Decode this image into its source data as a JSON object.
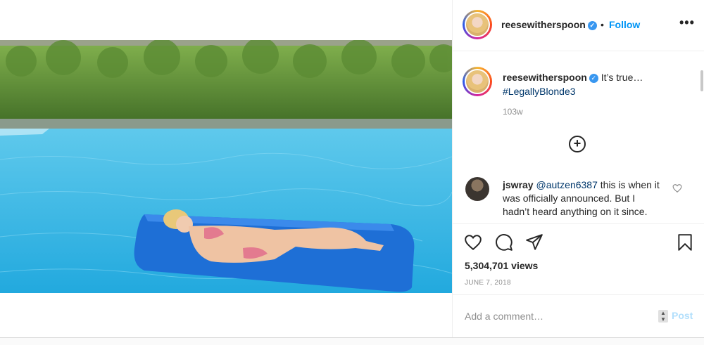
{
  "post": {
    "username": "reesewitherspoon",
    "separator": "•",
    "follow_label": "Follow",
    "more_label": "•••",
    "verified_mark": "✓",
    "caption": {
      "username": "reesewitherspoon",
      "text": "It’s true…",
      "hashtag": "#LegallyBlonde3",
      "time": "103w"
    },
    "load_more_label": "+",
    "comment": {
      "username": "jswray",
      "mention": "@autzen6387",
      "text": "this is when it was officially announced. But I hadn’t heard anything on it since."
    },
    "views": "5,304,701 views",
    "date": "JUNE 7, 2018",
    "add_comment_placeholder": "Add a comment…",
    "post_label": "Post"
  },
  "icons": {
    "like": "heart-icon",
    "comment": "comment-icon",
    "share": "paper-plane-icon",
    "save": "bookmark-icon",
    "more": "more-options-icon",
    "load_more": "plus-circle-icon",
    "verified": "verified-badge-icon"
  },
  "colors": {
    "follow": "#0095f6",
    "hashtag": "#00376b",
    "verified": "#3897f0",
    "muted": "#8e8e8e",
    "post_disabled": "#b2dffc"
  }
}
